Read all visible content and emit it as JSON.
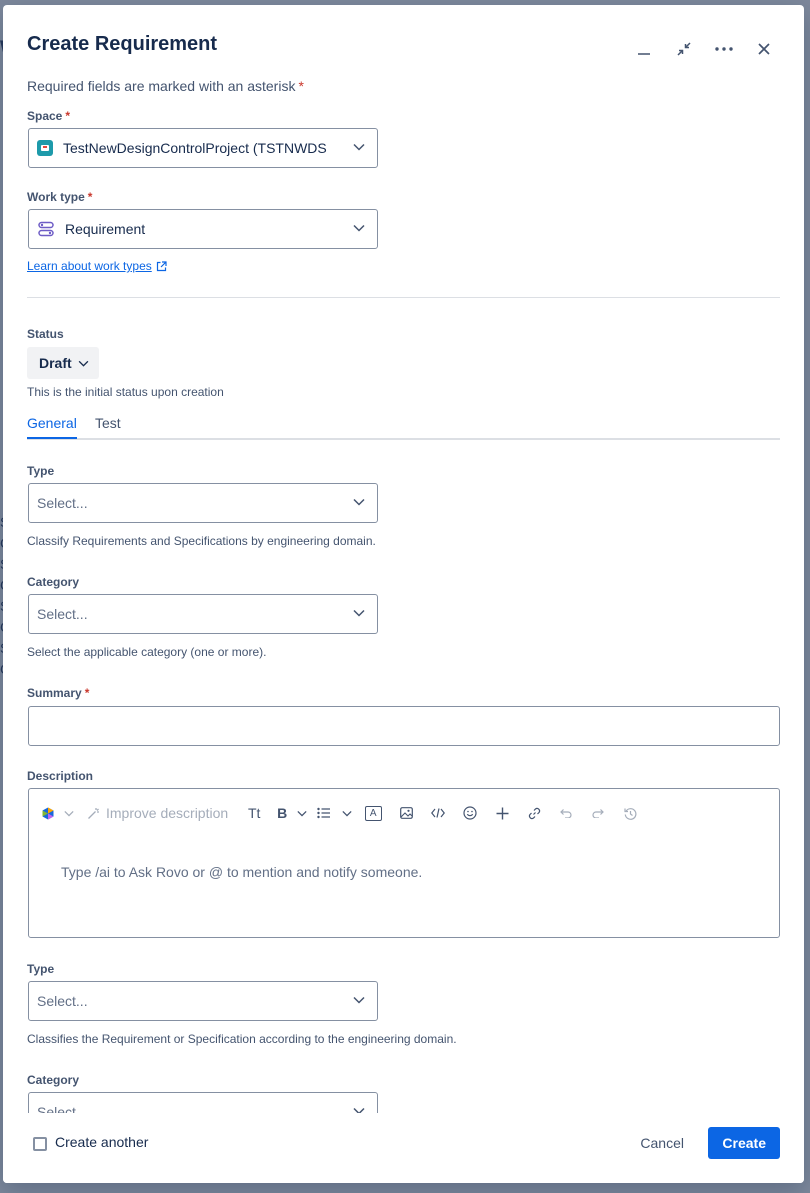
{
  "modal": {
    "title": "Create Requirement",
    "required_note": "Required fields are marked with an asterisk",
    "asterisk": "*"
  },
  "header_actions": [
    "minimize-icon",
    "collapse-icon",
    "more-icon",
    "close-icon"
  ],
  "space": {
    "label": "Space",
    "value": "TestNewDesignControlProject (TSTNWDS"
  },
  "work_type": {
    "label": "Work type",
    "value": "Requirement",
    "learn_link": "Learn about work types"
  },
  "status": {
    "label": "Status",
    "value": "Draft",
    "help": "This is the initial status upon creation"
  },
  "tabs": [
    {
      "label": "General",
      "active": true
    },
    {
      "label": "Test",
      "active": false
    }
  ],
  "type_field": {
    "label": "Type",
    "placeholder": "Select...",
    "help": "Classify Requirements and Specifications by engineering domain."
  },
  "category_field": {
    "label": "Category",
    "placeholder": "Select...",
    "help": "Select the applicable category (one or more)."
  },
  "summary": {
    "label": "Summary",
    "value": ""
  },
  "description": {
    "label": "Description",
    "improve": "Improve description",
    "text_style": "Tt",
    "bold": "B",
    "text_color": "A",
    "placeholder": "Type /ai to Ask Rovo or @ to mention and notify someone."
  },
  "type_field_2": {
    "label": "Type",
    "placeholder": "Select...",
    "help": "Classifies the Requirement or Specification according to the engineering domain."
  },
  "category_field_2": {
    "label": "Category",
    "placeholder": "Select..."
  },
  "footer": {
    "create_another": "Create another",
    "cancel": "Cancel",
    "create": "Create"
  },
  "colors": {
    "primary": "#0c66e4",
    "required": "#c9372c",
    "text": "#172b4d",
    "subtle": "#44546f"
  }
}
